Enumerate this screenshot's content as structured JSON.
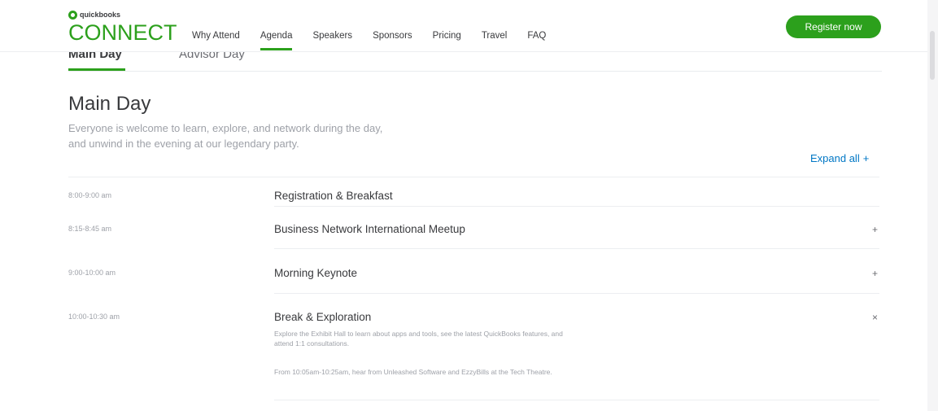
{
  "header": {
    "logo_small": "quickbooks",
    "logo_big": "CONNECT",
    "nav": [
      {
        "label": "Why Attend"
      },
      {
        "label": "Agenda"
      },
      {
        "label": "Speakers"
      },
      {
        "label": "Sponsors"
      },
      {
        "label": "Pricing"
      },
      {
        "label": "Travel"
      },
      {
        "label": "FAQ"
      }
    ],
    "register_label": "Register now",
    "brand_color": "#2ca01c"
  },
  "day_tabs": [
    {
      "label": "Main Day"
    },
    {
      "label": "Advisor Day"
    }
  ],
  "section": {
    "title": "Main Day",
    "description_line1": "Everyone is welcome to learn, explore, and network during the day,",
    "description_line2": "and unwind in the evening at our legendary party.",
    "expand_all_label": "Expand all",
    "expand_all_sign": "+"
  },
  "agenda": [
    {
      "time": "8:00-9:00 am",
      "title": "Registration & Breakfast",
      "toggle": ""
    },
    {
      "time": "8:15-8:45 am",
      "title": "Business Network International Meetup",
      "toggle": "+"
    },
    {
      "time": "9:00-10:00 am",
      "title": "Morning Keynote",
      "toggle": "+"
    },
    {
      "time": "10:00-10:30 am",
      "title": "Break & Exploration",
      "toggle": "×",
      "detail_line1": "Explore the Exhibit Hall to learn about apps and tools, see the latest QuickBooks features, and",
      "detail_line2": "attend 1:1 consultations.",
      "detail_line3": "From 10:05am-10:25am, hear from Unleashed Software and EzzyBills at the Tech Theatre."
    }
  ]
}
